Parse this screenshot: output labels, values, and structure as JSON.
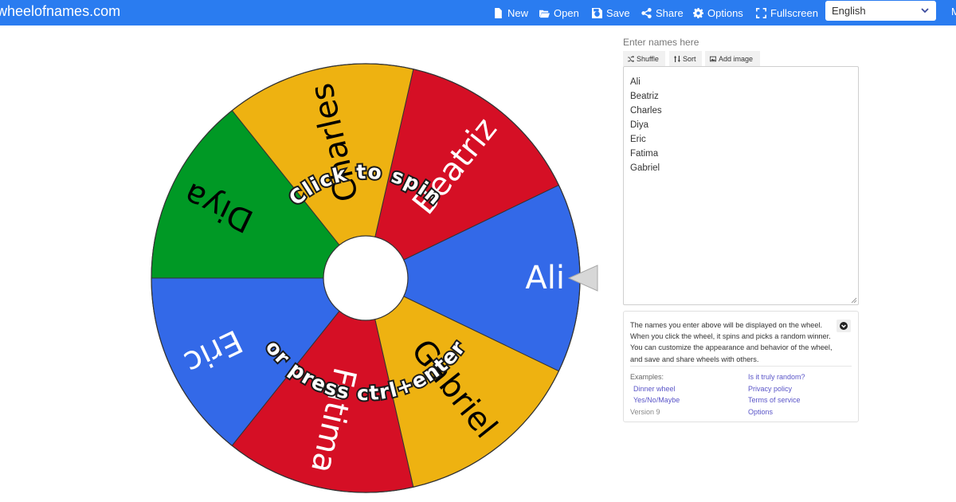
{
  "header": {
    "brand": "wheelofnames.com",
    "nav": {
      "new": "New",
      "open": "Open",
      "save": "Save",
      "share": "Share",
      "options": "Options",
      "fullscreen": "Fullscreen"
    },
    "language": "English",
    "corner_letter": "M",
    "background_color": "#2a7cf0"
  },
  "wheel": {
    "center_text_top": "Click to spin",
    "center_text_bottom": "or press ctrl+enter",
    "segments": [
      {
        "label": "Ali",
        "color": "#3369e8",
        "text_color": "#ffffff"
      },
      {
        "label": "Beatriz",
        "color": "#d50f25",
        "text_color": "#ffffff"
      },
      {
        "label": "Charles",
        "color": "#eeb211",
        "text_color": "#000000"
      },
      {
        "label": "Diya",
        "color": "#009925",
        "text_color": "#000000"
      },
      {
        "label": "Eric",
        "color": "#3369e8",
        "text_color": "#ffffff"
      },
      {
        "label": "Fatima",
        "color": "#d50f25",
        "text_color": "#ffffff"
      },
      {
        "label": "Gabriel",
        "color": "#eeb211",
        "text_color": "#000000"
      }
    ]
  },
  "editor": {
    "label": "Enter names here",
    "shuffle": "Shuffle",
    "sort": "Sort",
    "add_image": "Add image",
    "names": [
      "Ali",
      "Beatriz",
      "Charles",
      "Diya",
      "Eric",
      "Fatima",
      "Gabriel"
    ]
  },
  "info": {
    "description": "The names you enter above will be displayed on the wheel. When you click the wheel, it spins and picks a random winner. You can customize the appearance and behavior of the wheel, and save and share wheels with others.",
    "examples_label": "Examples:",
    "examples": [
      "Dinner wheel",
      "Yes/No/Maybe"
    ],
    "version": "Version 9",
    "links": [
      "Is it truly random?",
      "Privacy policy",
      "Terms of service",
      "Options"
    ]
  }
}
